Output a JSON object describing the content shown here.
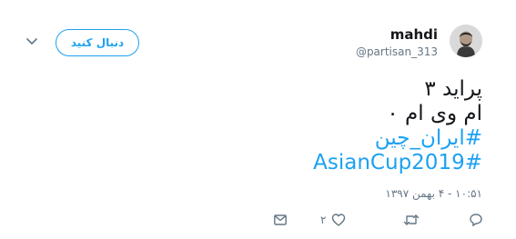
{
  "header": {
    "follow_label": "دنبال کنید",
    "display_name": "mahdi",
    "handle": "@partisan_313"
  },
  "tweet": {
    "line1": "پراید ۳",
    "line2": "ام وی ام ۰",
    "hashtag1": "#ایران_چین",
    "hashtag2": "#AsianCup2019"
  },
  "meta": {
    "timestamp": "۱۰:۵۱ - ۴ بهمن ۱۳۹۷"
  },
  "actions": {
    "like_count": "۲"
  },
  "icons": [
    "chevron-down-icon",
    "avatar",
    "reply-icon",
    "retweet-icon",
    "like-icon",
    "message-icon"
  ],
  "colors": {
    "accent": "#1da1f2",
    "text": "#14171a",
    "muted": "#657786"
  }
}
